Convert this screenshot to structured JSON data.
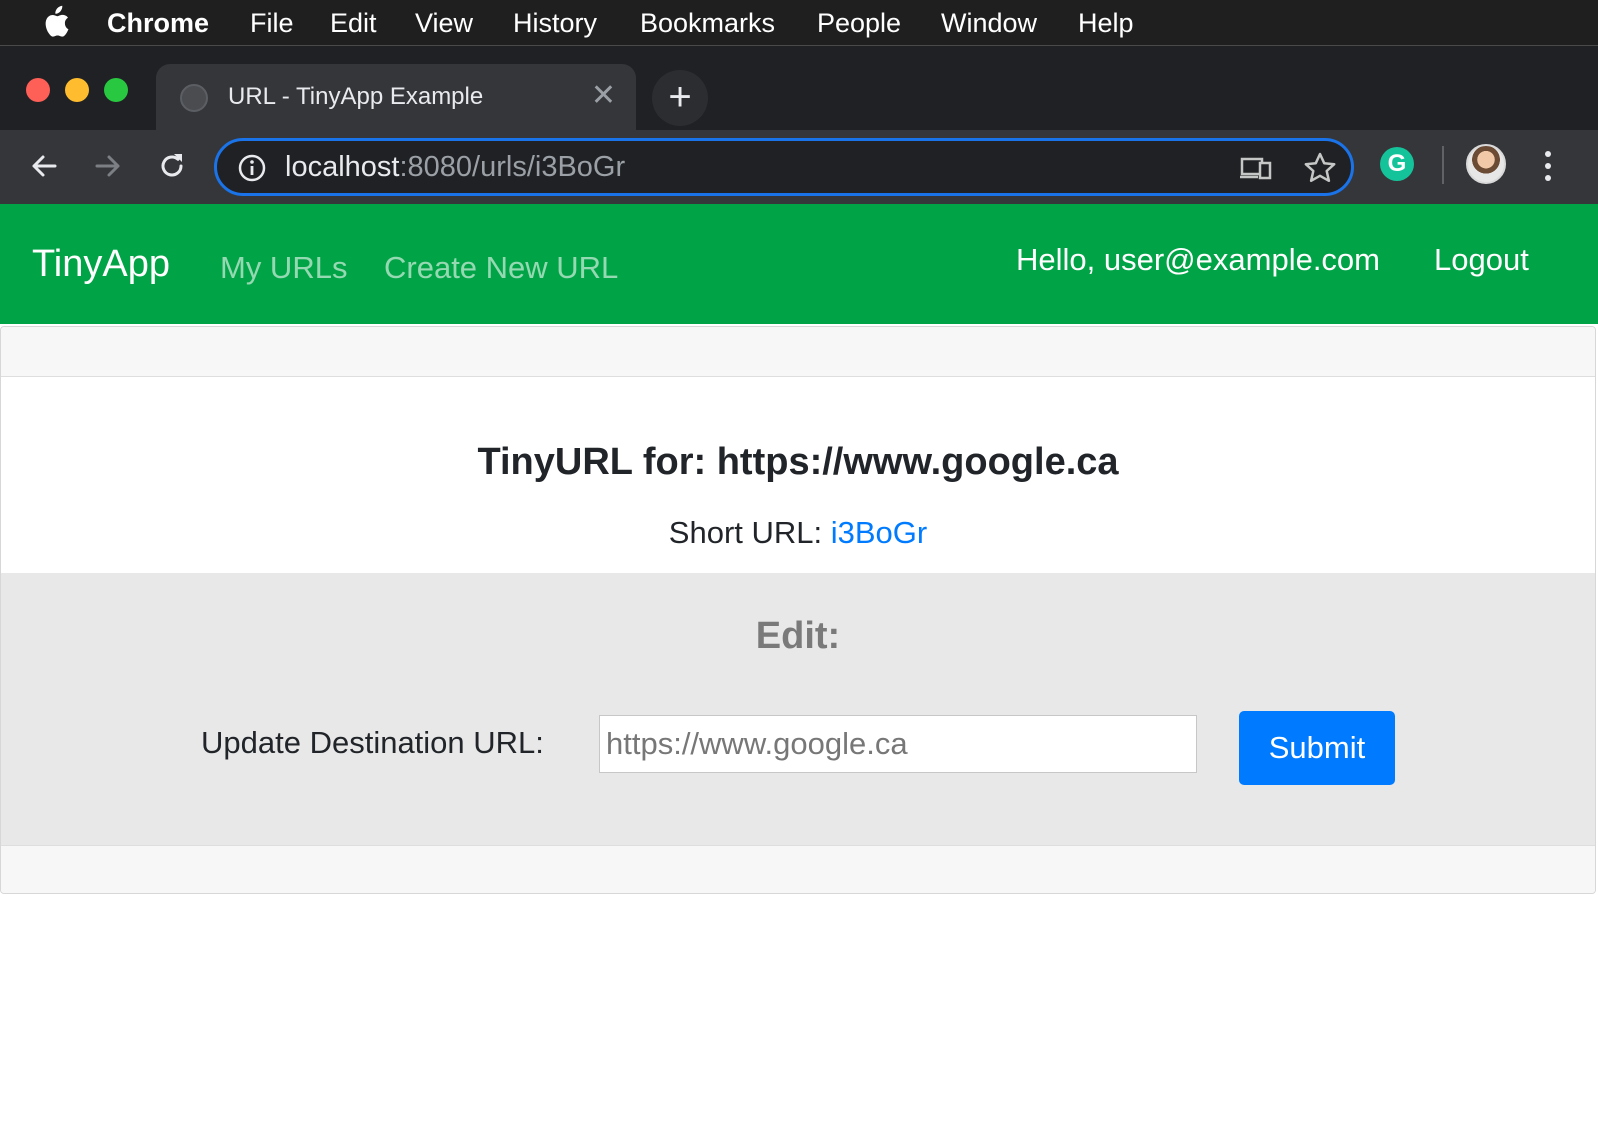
{
  "menubar": {
    "app": "Chrome",
    "items": [
      "File",
      "Edit",
      "View",
      "History",
      "Bookmarks",
      "People",
      "Window",
      "Help"
    ]
  },
  "browser": {
    "tab_title": "URL - TinyApp Example",
    "address": {
      "host": "localhost",
      "path": ":8080/urls/i3BoGr"
    }
  },
  "navbar": {
    "brand": "TinyApp",
    "links": [
      "My URLs",
      "Create New URL"
    ],
    "greeting": "Hello, user@example.com",
    "logout": "Logout",
    "bg_color": "#00a446"
  },
  "card": {
    "title": "TinyURL for: https://www.google.ca",
    "short_url_label": "Short URL: ",
    "short_url_value": "i3BoGr",
    "edit_heading": "Edit:",
    "form_label": "Update Destination URL:",
    "input_placeholder": "https://www.google.ca",
    "submit_label": "Submit",
    "link_color": "#007bff"
  }
}
